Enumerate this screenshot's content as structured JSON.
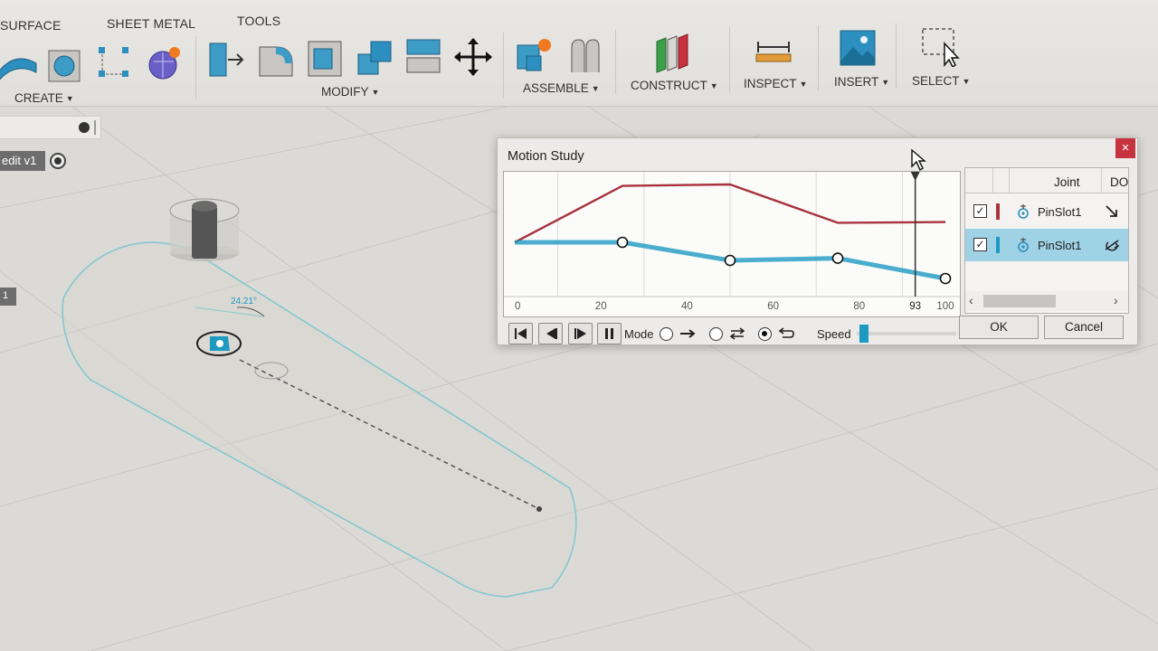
{
  "toolbar": {
    "workspace_tabs": [
      "SURFACE",
      "SHEET METAL",
      "TOOLS"
    ],
    "groups": {
      "create": "CREATE",
      "modify": "MODIFY",
      "assemble": "ASSEMBLE",
      "construct": "CONSTRUCT",
      "inspect": "INSPECT",
      "insert": "INSERT",
      "select": "SELECT"
    }
  },
  "browser": {
    "component_label": "edit v1",
    "side_tag": "1"
  },
  "sketch": {
    "dimension_text": "24.21°"
  },
  "motion_study": {
    "title": "Motion Study",
    "close_label": "×",
    "x_ticks": [
      "0",
      "20",
      "40",
      "60",
      "80",
      "93",
      "100"
    ],
    "current_position": "93",
    "controls": {
      "mode_label": "Mode",
      "speed_label": "Speed",
      "speed_level": 0.03,
      "selected_mode": "loop"
    },
    "table": {
      "headers": {
        "joint": "Joint",
        "dof": "DOF"
      },
      "rows": [
        {
          "name": "PinSlot1",
          "checked": true,
          "color": "#a8323c",
          "selected": false,
          "dof_icon": "arrow-diagonal-icon"
        },
        {
          "name": "PinSlot1",
          "checked": true,
          "color": "#1e9ac2",
          "selected": true,
          "dof_icon": "rotate-icon"
        }
      ]
    },
    "ok_label": "OK",
    "cancel_label": "Cancel"
  },
  "chart_data": {
    "type": "line",
    "xlim": [
      0,
      100
    ],
    "x_ticks": [
      0,
      20,
      40,
      60,
      80,
      93,
      100
    ],
    "grid": true,
    "current_x": 93,
    "series": [
      {
        "color": "#a8323c",
        "x": [
          0,
          25,
          50,
          75,
          100
        ],
        "y": [
          0.9,
          0.12,
          0.1,
          0.63,
          0.62
        ],
        "keypoints": false
      },
      {
        "color": "#1e9ac2",
        "x": [
          0,
          25,
          50,
          75,
          100
        ],
        "y": [
          0.9,
          0.9,
          1.15,
          1.12,
          1.4
        ],
        "keypoints": true
      }
    ]
  },
  "colors": {
    "accent": "#1e9ac2",
    "close_button": "#c6323e"
  }
}
